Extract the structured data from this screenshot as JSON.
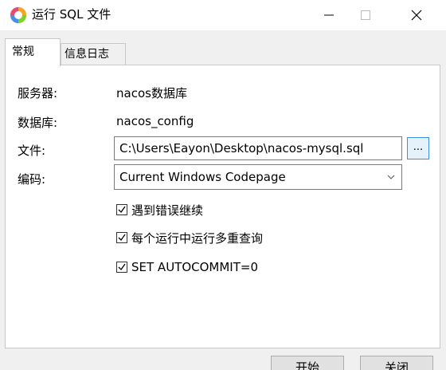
{
  "window": {
    "title": "运行 SQL 文件",
    "icon": "app-logo-icon"
  },
  "tabs": [
    {
      "label": "常规",
      "active": true
    },
    {
      "label": "信息日志",
      "active": false
    }
  ],
  "form": {
    "server_label": "服务器:",
    "server_value": "nacos数据库",
    "database_label": "数据库:",
    "database_value": "nacos_config",
    "file_label": "文件:",
    "file_value": "C:\\Users\\Eayon\\Desktop\\nacos-mysql.sql",
    "browse_label": "...",
    "encoding_label": "编码:",
    "encoding_value": "Current Windows Codepage"
  },
  "options": [
    {
      "label": "遇到错误继续",
      "checked": true
    },
    {
      "label": "每个运行中运行多重查询",
      "checked": true
    },
    {
      "label": "SET AUTOCOMMIT=0",
      "checked": true
    }
  ],
  "buttons": {
    "start": "开始",
    "close": "关闭"
  }
}
